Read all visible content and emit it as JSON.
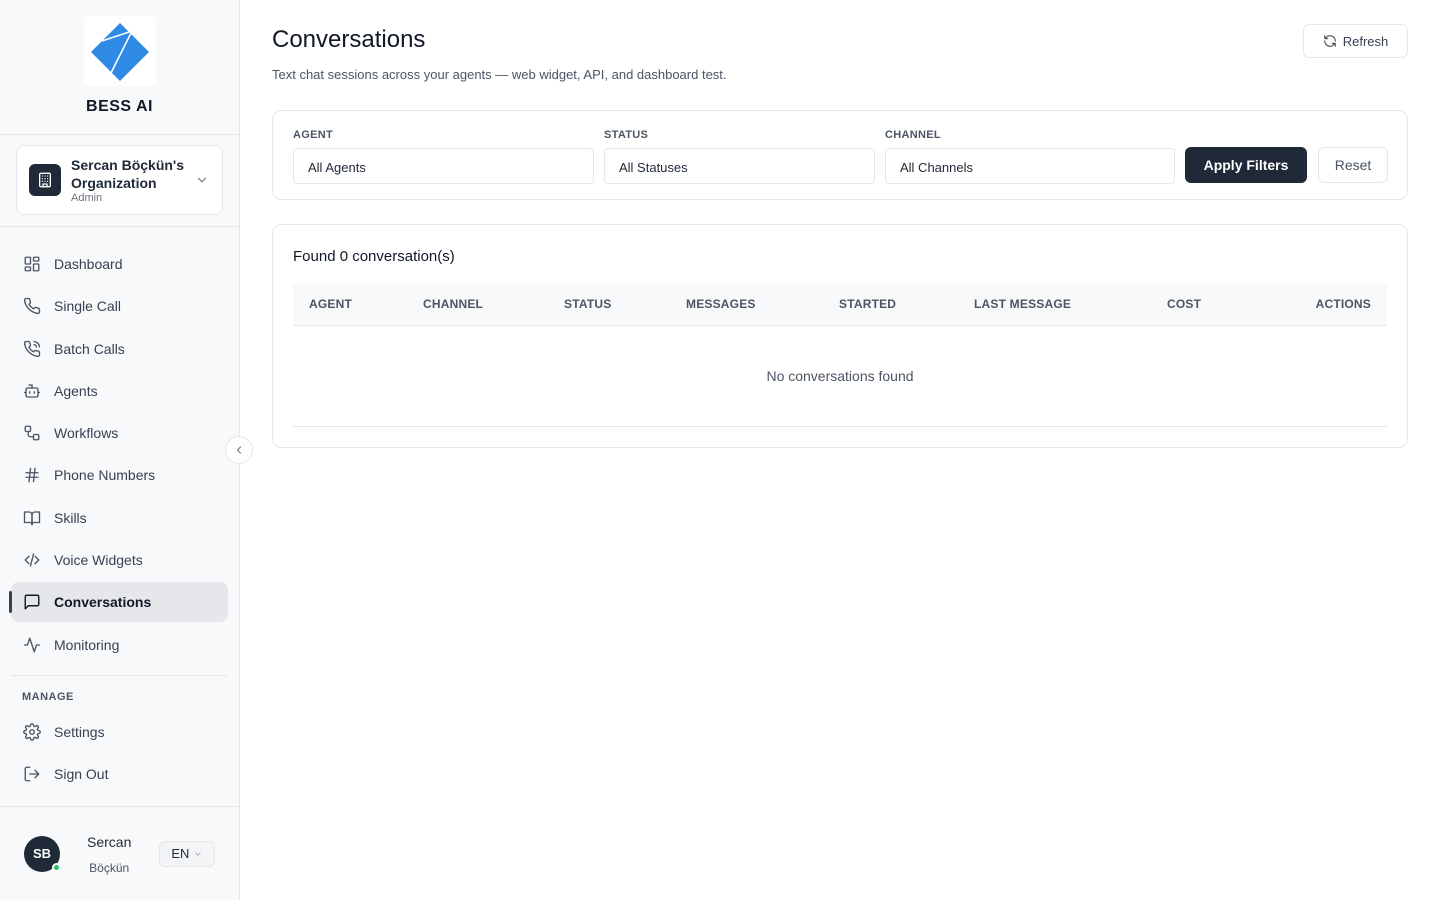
{
  "brand": {
    "name": "BESS AI",
    "accent": "#2f8ae6"
  },
  "org": {
    "name": "Sercan Böçkün's Organization",
    "role": "Admin"
  },
  "nav": {
    "items": [
      {
        "label": "Dashboard",
        "icon": "grid-icon"
      },
      {
        "label": "Single Call",
        "icon": "phone-icon"
      },
      {
        "label": "Batch Calls",
        "icon": "phone-ring-icon"
      },
      {
        "label": "Agents",
        "icon": "bot-icon"
      },
      {
        "label": "Workflows",
        "icon": "workflow-icon"
      },
      {
        "label": "Phone Numbers",
        "icon": "hash-icon"
      },
      {
        "label": "Skills",
        "icon": "book-icon"
      },
      {
        "label": "Voice Widgets",
        "icon": "code-icon"
      },
      {
        "label": "Conversations",
        "icon": "message-icon",
        "active": true
      },
      {
        "label": "Monitoring",
        "icon": "activity-icon"
      }
    ],
    "manage_label": "MANAGE",
    "manage": [
      {
        "label": "Settings",
        "icon": "gear-icon"
      },
      {
        "label": "Sign Out",
        "icon": "logout-icon"
      }
    ]
  },
  "user": {
    "initials": "SB",
    "first": "Sercan",
    "last": "Böçkün",
    "lang": "EN",
    "status_color": "#22c55e"
  },
  "page": {
    "title": "Conversations",
    "subtitle": "Text chat sessions across your agents — web widget, API, and dashboard test.",
    "refresh_label": "Refresh"
  },
  "filters": {
    "agent": {
      "label": "AGENT",
      "value": "All Agents"
    },
    "status": {
      "label": "STATUS",
      "value": "All Statuses"
    },
    "channel": {
      "label": "CHANNEL",
      "value": "All Channels"
    },
    "apply_label": "Apply Filters",
    "reset_label": "Reset"
  },
  "results": {
    "found_text": "Found 0 conversation(s)",
    "columns": [
      "AGENT",
      "CHANNEL",
      "STATUS",
      "MESSAGES",
      "STARTED",
      "LAST MESSAGE",
      "COST",
      "ACTIONS"
    ],
    "rows": [],
    "empty_text": "No conversations found"
  }
}
